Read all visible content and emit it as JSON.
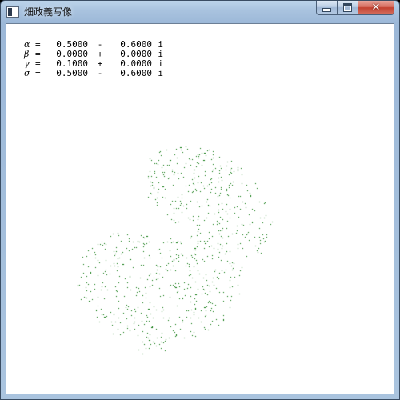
{
  "window": {
    "title": "畑政義写像",
    "buttons": {
      "minimize": "minimize",
      "maximize": "maximize",
      "close": "✕"
    }
  },
  "parameters": [
    {
      "symbol": "α",
      "eq": "=",
      "real": "0.5000",
      "op": "-",
      "imag": "0.6000",
      "unit": "i"
    },
    {
      "symbol": "β",
      "eq": "=",
      "real": "0.0000",
      "op": "+",
      "imag": "0.0000",
      "unit": "i"
    },
    {
      "symbol": "γ",
      "eq": "=",
      "real": "0.1000",
      "op": "+",
      "imag": "0.0000",
      "unit": "i"
    },
    {
      "symbol": "σ",
      "eq": "=",
      "real": "0.5000",
      "op": "-",
      "imag": "0.6000",
      "unit": "i"
    }
  ],
  "fractal": {
    "color": "#007000",
    "icon": "hata-map-fractal"
  },
  "colors": {
    "background": "#ffffff",
    "text": "#000000"
  }
}
